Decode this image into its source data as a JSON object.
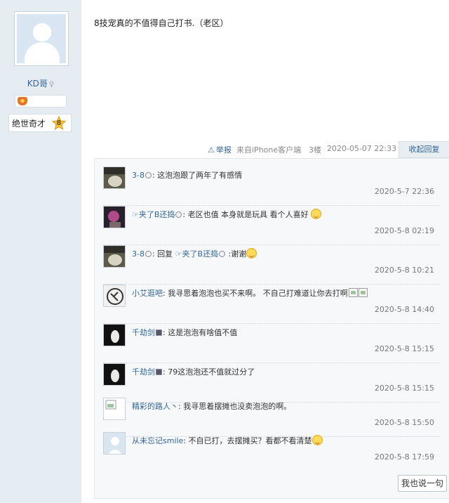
{
  "author": {
    "name": "KD哥",
    "gender_icon": "♀",
    "rank_title": "绝世奇才",
    "rank_level": "8"
  },
  "post": {
    "text": "8技宠真的不值得自己打书.（老区）"
  },
  "meta": {
    "report_label": "举报",
    "client": "来自iPhone客户端",
    "floor": "3楼",
    "datetime": "2020-05-07 22:33",
    "collapse_label": "收起回复"
  },
  "comments": [
    {
      "name": "3-8",
      "prefix": "",
      "text": ": 这泡泡跟了两年了有感情",
      "date": "2020-5-7 22:36",
      "avatar": "photo-dark"
    },
    {
      "name": "夹了B还捣",
      "prefix": "☞",
      "text": ": 老区也值  本身就是玩具  看个人喜好",
      "date": "2020-5-8 02:19",
      "avatar": "photo-purple"
    },
    {
      "name": "3-8",
      "prefix": "",
      "text": ": 回复 ",
      "reply_to": "☞夹了B还捣",
      "text2": " :谢谢",
      "date": "2020-5-8 10:21",
      "avatar": "photo-dark"
    },
    {
      "name": "小艾逛吧",
      "prefix": "",
      "text": ": 我寻思着泡泡也买不来啊。 不自己打难道让你去打啊",
      "date": "2020-5-8 14:40",
      "avatar": "logo-circle"
    },
    {
      "name": "千劫剑",
      "prefix": "",
      "text": ": 这是泡泡有啥值不值",
      "date": "2020-5-8 15:15",
      "avatar": "photo-black"
    },
    {
      "name": "千劫剑",
      "prefix": "",
      "text": ": 79这泡泡还不值就过分了",
      "date": "2020-5-8 15:15",
      "avatar": "photo-black"
    },
    {
      "name": "精彩的路人丶",
      "prefix": "",
      "text": ": 我寻思着摆摊也没卖泡泡的啊。",
      "date": "2020-5-8 15:50",
      "avatar": "broken"
    },
    {
      "name": "从未忘记smile",
      "prefix": "",
      "text": ": 不自已打，去摆摊买？看都不看清楚",
      "date": "2020-5-8 17:59",
      "avatar": "default"
    }
  ],
  "say_button": "我也说一句",
  "colors": {
    "sidebar_bg": "#e5edf2",
    "link": "#336699",
    "comment_bg": "#f6f8f9"
  }
}
